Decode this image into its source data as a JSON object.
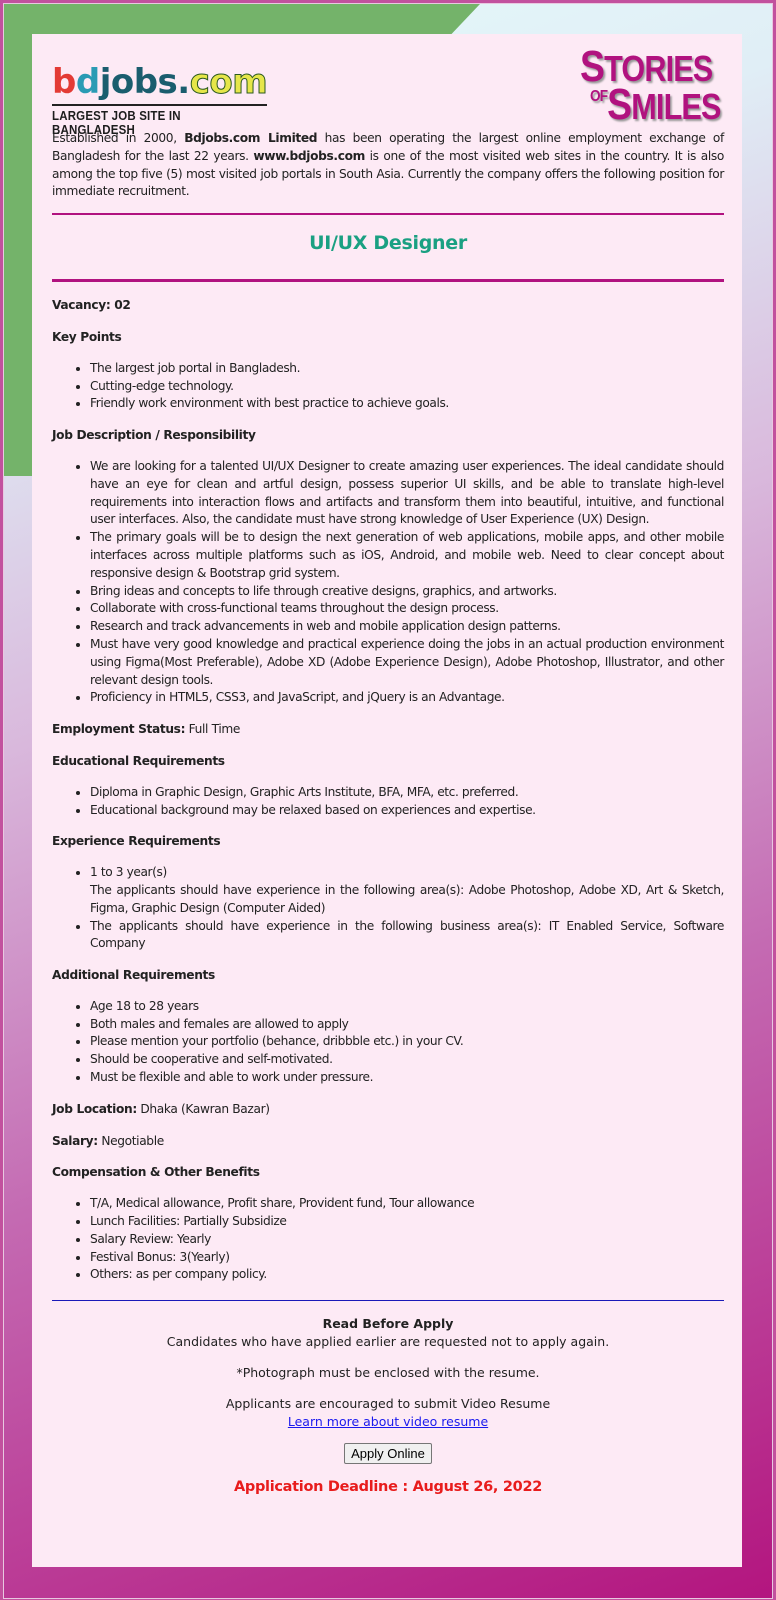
{
  "header": {
    "logo": {
      "parts": [
        "b",
        "d",
        "jobs",
        ".",
        "com"
      ],
      "tagline": "LARGEST JOB SITE IN BANGLADESH"
    },
    "campaign_logo": {
      "line1_initial": "S",
      "line1_rest": "TORIES",
      "line2_prefix": "OF",
      "line2_initial": "S",
      "line2_rest": "MILES"
    }
  },
  "intro": {
    "t1": "Established in 2000, ",
    "b1": "Bdjobs.com Limited",
    "t2": " has been operating the largest online employment exchange of Bangladesh for the last 22 years. ",
    "b2": "www.bdjobs.com",
    "t3": " is one of the most visited web sites in the country. It is also among the top five (5) most visited job portals in South Asia. Currently the company offers the following position for immediate recruitment."
  },
  "job_title": "UI/UX Designer",
  "vacancy": "Vacancy: 02",
  "key_points": {
    "heading": "Key Points",
    "items": [
      "The largest job portal in Bangladesh.",
      "Cutting-edge technology.",
      "Friendly work environment with best practice to achieve goals."
    ]
  },
  "responsibilities": {
    "heading": "Job Description / Responsibility",
    "items": [
      "We are looking for a talented UI/UX Designer to create amazing user experiences. The ideal candidate should have an eye for clean and artful design, possess superior UI skills, and be able to translate high-level requirements into interaction flows and artifacts and transform them into beautiful, intuitive, and functional user interfaces. Also, the candidate must have strong knowledge of User Experience (UX) Design.",
      "The primary goals will be to design the next generation of web applications, mobile apps, and other mobile interfaces across multiple platforms such as iOS, Android, and mobile web. Need to clear concept about responsive design & Bootstrap grid system.",
      "Bring ideas and concepts to life through creative designs, graphics, and artworks.",
      "Collaborate with cross-functional teams throughout the design process.",
      "Research and track advancements in web and mobile application design patterns.",
      "Must have very good knowledge and practical experience doing the jobs in an actual production environment using Figma(Most Preferable), Adobe XD (Adobe Experience Design), Adobe Photoshop, Illustrator, and other relevant design tools.",
      "Proficiency in HTML5, CSS3, and JavaScript, and jQuery is an Advantage."
    ]
  },
  "employment_status": {
    "label": "Employment Status:",
    "value": " Full Time"
  },
  "education": {
    "heading": "Educational Requirements",
    "items": [
      "Diploma in Graphic Design, Graphic Arts Institute, BFA, MFA, etc. preferred.",
      "Educational background may be relaxed based on experiences and expertise."
    ]
  },
  "experience": {
    "heading": "Experience Requirements",
    "item1_line1": "1 to 3 year(s)",
    "item1_line2": "The applicants should have experience in the following area(s): Adobe Photoshop, Adobe XD, Art & Sketch, Figma, Graphic Design (Computer Aided)",
    "item2": "The applicants should have experience in the following business area(s): IT Enabled Service, Software Company"
  },
  "additional": {
    "heading": "Additional Requirements",
    "items": [
      "Age 18 to 28 years",
      "Both males and females are allowed to apply",
      "Please mention your portfolio (behance, dribbble etc.) in your CV.",
      "Should be cooperative and self-motivated.",
      "Must be flexible and able to work under pressure."
    ]
  },
  "location": {
    "label": "Job Location:",
    "value": " Dhaka (Kawran Bazar)"
  },
  "salary": {
    "label": "Salary:",
    "value": " Negotiable"
  },
  "benefits": {
    "heading": "Compensation & Other Benefits",
    "items": [
      "T/A, Medical allowance, Profit share, Provident fund, Tour allowance",
      "Lunch Facilities: Partially Subsidize",
      "Salary Review: Yearly",
      "Festival Bonus: 3(Yearly)",
      "Others: as per company policy."
    ]
  },
  "footer": {
    "read_before_apply": "Read Before Apply",
    "notice": "Candidates who have applied earlier are requested not to apply again.",
    "photo_note": "*Photograph must be enclosed with the resume.",
    "video_note": "Applicants are encouraged to submit Video Resume",
    "video_link": "Learn more about video resume",
    "apply_button": "Apply Online",
    "deadline": "Application Deadline : August 26, 2022"
  },
  "colors": {
    "accent": "#b1127f",
    "title": "#1aa082",
    "deadline": "#e81c1c",
    "card_bg": "#fdeaf5"
  }
}
